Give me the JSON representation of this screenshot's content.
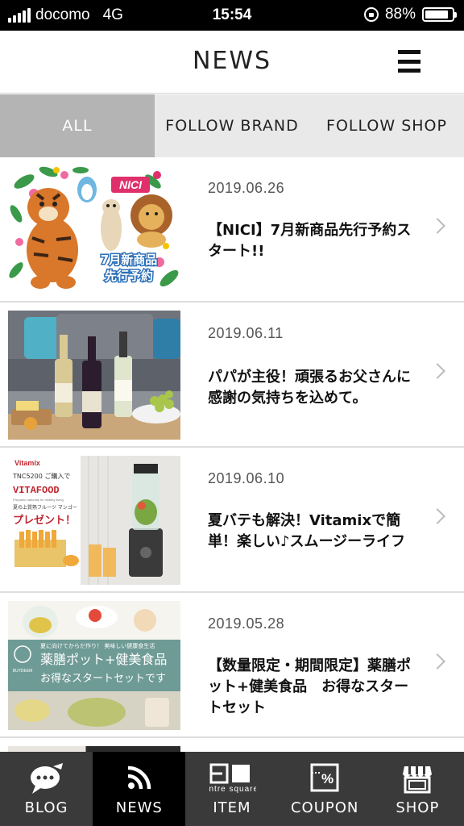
{
  "status_bar": {
    "carrier": "docomo",
    "network": "4G",
    "time": "15:54",
    "battery": "88%",
    "battery_level": 0.88
  },
  "header": {
    "title": "NEWS",
    "menu_icon": "hamburger-icon"
  },
  "tabs": [
    {
      "label": "ALL",
      "active": true
    },
    {
      "label": "FOLLOW BRAND",
      "active": false
    },
    {
      "label": "FOLLOW SHOP",
      "active": false
    }
  ],
  "news": [
    {
      "date": "2019.06.26",
      "title": "【NICI】7月新商品先行予約スタート!!",
      "image_text": {
        "brand": "NICI",
        "caption": "7月新商品\n先行予約"
      }
    },
    {
      "date": "2019.06.11",
      "title": "パパが主役！頑張るお父さんに感謝の気持ちを込めて。",
      "image_text": {}
    },
    {
      "date": "2019.06.10",
      "title": "夏バテも解決！Vitamixで簡単！楽しい♪スムージーライフ",
      "image_text": {
        "brand": "Vitamix",
        "line1": "TNC5200 ご購入で",
        "line2": "VITAFOOD",
        "line3": "Prepared naturally for healthy living",
        "line4": "夏の上質熟フルーツ マンゴー",
        "line5": "プレゼント！"
      }
    },
    {
      "date": "2019.05.28",
      "title": "【数量限定・期間限定】薬膳ポット+健美食品　お得なスタートセット",
      "image_text": {
        "tag": "夏に向けてからだ作り！ 美味しい健康食生活",
        "line1": "薬膳ポット+健美食品",
        "line2": "お得なスタートセットです",
        "brand": "BUYDEEM"
      }
    }
  ],
  "bottom_nav": [
    {
      "label": "BLOG",
      "icon": "blog-speech-bubble-icon",
      "active": false
    },
    {
      "label": "NEWS",
      "icon": "news-rss-icon",
      "active": true
    },
    {
      "label": "ITEM",
      "icon": "entre-square-item-icon",
      "icon_text": "entre square",
      "active": false
    },
    {
      "label": "COUPON",
      "icon": "coupon-ticket-icon",
      "active": false
    },
    {
      "label": "SHOP",
      "icon": "shop-storefront-icon",
      "active": false
    }
  ],
  "colors": {
    "tab_active_bg": "#b4b4b4",
    "tab_bg": "#e9e9e9",
    "nav_bg": "#3a3a3a",
    "nav_active_bg": "#000000"
  }
}
